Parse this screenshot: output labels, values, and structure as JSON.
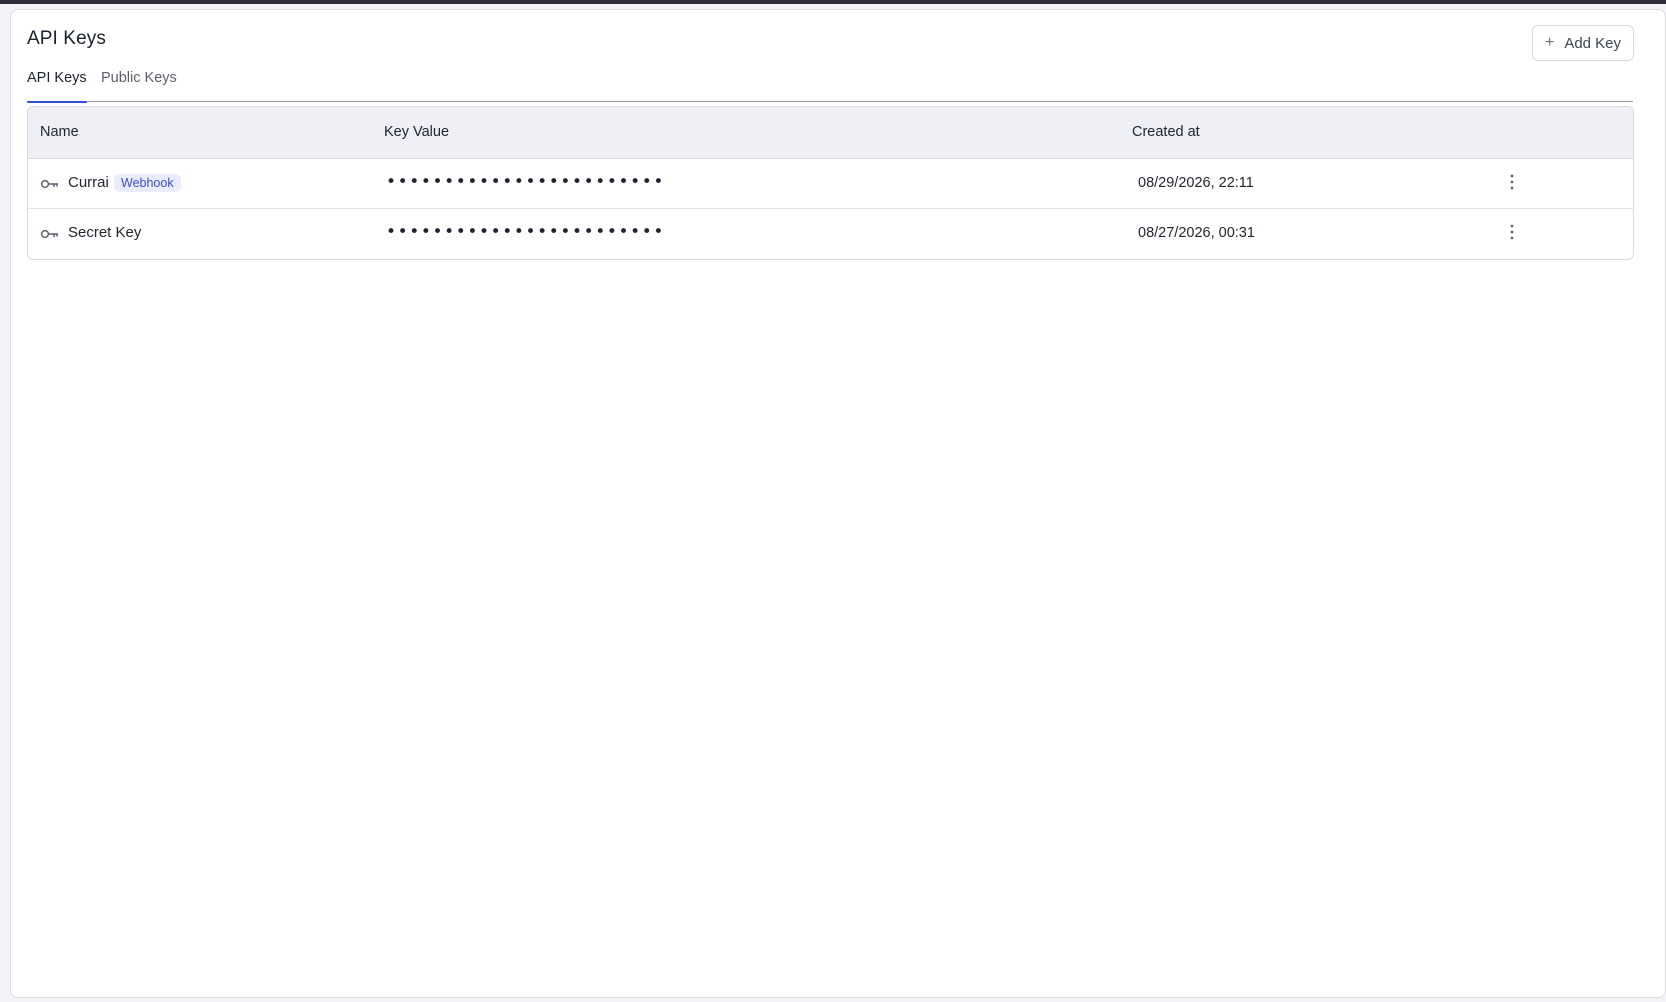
{
  "page": {
    "title": "API Keys",
    "add_button_label": "Add Key",
    "accent_color": "#2f4fd6"
  },
  "tabs": [
    {
      "label": "API Keys",
      "active": true
    },
    {
      "label": "Public Keys",
      "active": false
    }
  ],
  "table": {
    "columns": [
      "Name",
      "Key Value",
      "Created at"
    ],
    "rows": [
      {
        "name": "Currai",
        "badge": "Webhook",
        "key_value": "••••••••••••••••••••••••",
        "created_at": "08/29/2026, 22:11"
      },
      {
        "name": "Secret Key",
        "badge": "",
        "key_value": "••••••••••••••••••••••••",
        "created_at": "08/27/2026, 00:31"
      }
    ]
  },
  "icons": {
    "add": "plus-icon",
    "row": "key-icon",
    "menu": "more-vertical-icon"
  }
}
